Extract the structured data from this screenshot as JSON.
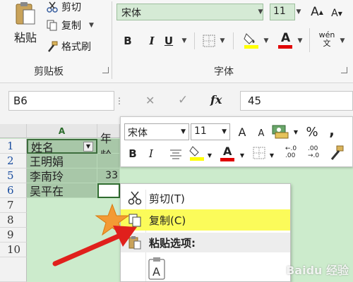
{
  "ribbon": {
    "paste_label": "粘贴",
    "cut_label": "剪切",
    "copy_label": "复制",
    "format_painter_label": "格式刷",
    "clipboard_group": "剪贴板",
    "font_group": "字体",
    "font_name": "宋体",
    "font_size": "11",
    "bold": "B",
    "italic": "I",
    "underline": "U",
    "font_color_glyph": "A",
    "phonetic_glyph": "wén\n文",
    "grow_font": "A",
    "shrink_font": "A"
  },
  "formula_bar": {
    "name_box": "B6",
    "cancel": "✕",
    "enter": "✓",
    "fx": "fx",
    "value": "45"
  },
  "sheet": {
    "col_a": "A",
    "col_b_partial": "年龄",
    "rows": [
      {
        "num": "1",
        "a": "姓名",
        "b": "",
        "blue": true
      },
      {
        "num": "2",
        "a": "王明娟",
        "b": "",
        "blue": true
      },
      {
        "num": "5",
        "a": "李南玲",
        "b": "33",
        "blue": true
      },
      {
        "num": "6",
        "a": "吴平在",
        "b": "",
        "blue": true
      },
      {
        "num": "7",
        "a": "",
        "b": "",
        "blue": false
      },
      {
        "num": "8",
        "a": "",
        "b": "",
        "blue": false
      },
      {
        "num": "9",
        "a": "",
        "b": "",
        "blue": false
      },
      {
        "num": "10",
        "a": "",
        "b": "",
        "blue": false
      }
    ]
  },
  "mini_toolbar": {
    "font_name": "宋体",
    "font_size": "11",
    "percent": "%",
    "comma": ",",
    "bold": "B",
    "italic": "I"
  },
  "context_menu": {
    "cut": "剪切(T)",
    "copy": "复制(C)",
    "paste_options": "粘贴选项:"
  },
  "colors": {
    "highlight": "#fbfb5a",
    "font_color_bar": "#e00000",
    "fill_color_bar": "#ffff00",
    "selection_green": "#ccebcc",
    "arrow_red": "#e0201c"
  },
  "watermark": "Baidu 经验"
}
